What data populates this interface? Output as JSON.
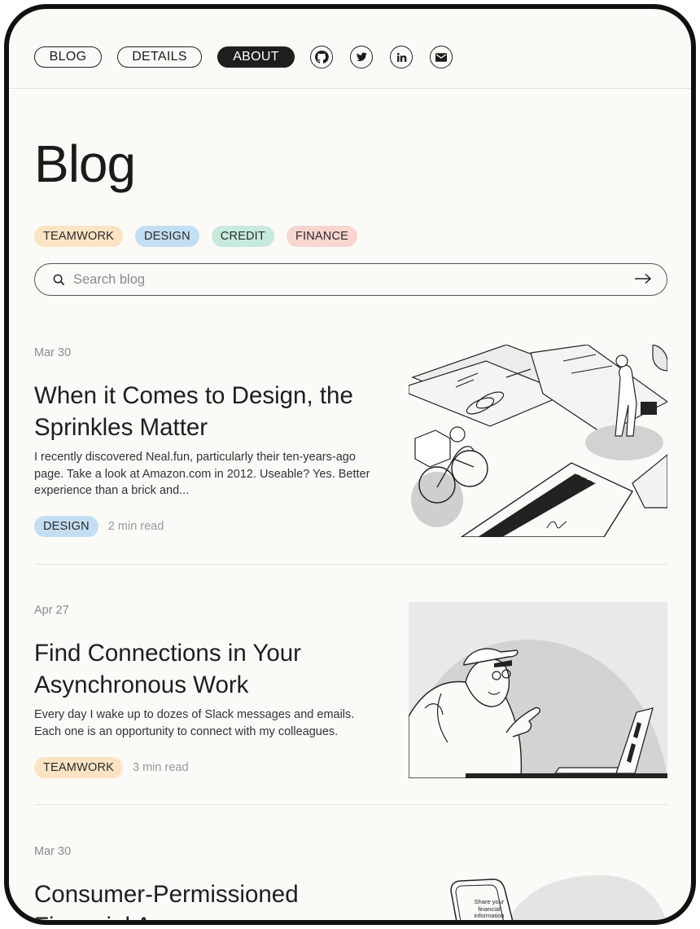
{
  "nav": {
    "links": [
      "BLOG",
      "DETAILS",
      "ABOUT"
    ],
    "icons": [
      "github-icon",
      "twitter-icon",
      "linkedin-icon",
      "email-icon"
    ]
  },
  "page_title": "Blog",
  "tags": [
    {
      "label": "TEAMWORK",
      "color": "#fbe3c3"
    },
    {
      "label": "DESIGN",
      "color": "#c3def3"
    },
    {
      "label": "CREDIT",
      "color": "#c6ebdd"
    },
    {
      "label": "FINANCE",
      "color": "#f8d5cf"
    }
  ],
  "search": {
    "placeholder": "Search blog"
  },
  "posts": [
    {
      "date": "Mar 30",
      "title": "When it Comes to Design, the Sprinkles Matter",
      "excerpt": "I recently discovered Neal.fun, particularly their ten-years-ago page. Take a look at Amazon.com in 2012. Useable? Yes. Better experience than a brick and...",
      "tag": "DESIGN",
      "read_time": "2 min read"
    },
    {
      "date": "Apr 27",
      "title": "Find Connections in Your Asynchronous Work",
      "excerpt": "Every day I wake up to dozes of Slack messages and emails. Each one is an opportunity to connect with my colleagues.",
      "tag": "TEAMWORK",
      "read_time": "3 min read"
    },
    {
      "date": "Mar 30",
      "title": "Consumer-Permissioned Financial Access",
      "illustration_text": "Share your financial information"
    }
  ]
}
